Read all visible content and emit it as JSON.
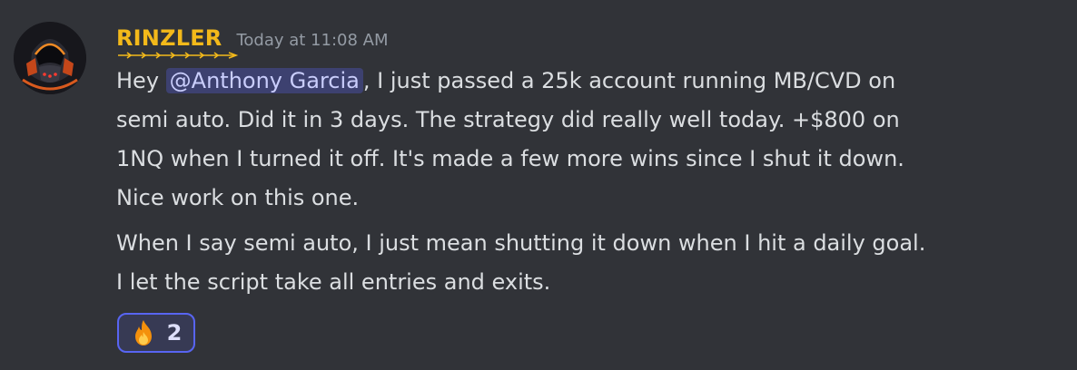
{
  "message": {
    "author": "RINZLER",
    "timestamp": "Today at 11:08 AM",
    "paragraph1": {
      "before_mention": "Hey ",
      "mention": "@Anthony Garcia",
      "line1_after": ", I just passed a 25k account running MB/CVD on",
      "line2": "semi auto. Did it in 3 days. The strategy did really well today. +$800 on",
      "line3": "1NQ when I turned it off.  It's made a few more wins since I shut it down.",
      "line4": "Nice work on this one."
    },
    "paragraph2": {
      "line1": "When I say semi auto, I just mean shutting it down when I hit a daily goal.",
      "line2": "I let the script take all entries and exits."
    },
    "reaction": {
      "emoji": "fire-emoji",
      "count": "2"
    }
  },
  "colors": {
    "background": "#313338",
    "username": "#f3b91a",
    "text": "#dbdee1",
    "timestamp": "#949ba4",
    "mention_bg": "#5865f2",
    "reaction_border": "#5865f2"
  }
}
